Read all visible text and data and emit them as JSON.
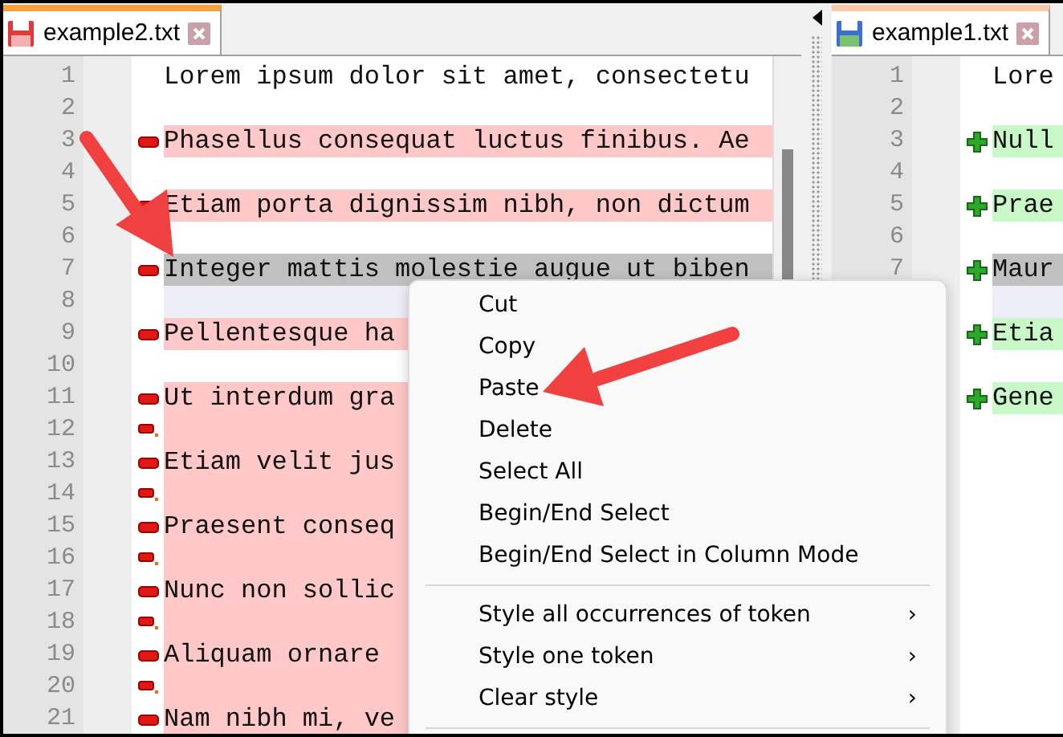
{
  "left_pane": {
    "tab": {
      "title": "example2.txt",
      "selected": true,
      "modified": true
    },
    "lines": [
      {
        "number": "1",
        "kind": "plain",
        "current": false,
        "text": "Lorem ipsum dolor sit amet, consectetu"
      },
      {
        "number": "2",
        "kind": "plain",
        "current": false
      },
      {
        "number": "3",
        "kind": "removed",
        "current": false,
        "text": "Phasellus consequat luctus finibus. Ae"
      },
      {
        "number": "4",
        "kind": "plain",
        "current": false
      },
      {
        "number": "5",
        "kind": "removed",
        "current": false,
        "text": "Etiam porta dignissim nibh, non dictum"
      },
      {
        "number": "6",
        "kind": "plain",
        "current": false
      },
      {
        "number": "7",
        "kind": "removed",
        "current": true,
        "text": "Integer mattis molestie augue ut biben"
      },
      {
        "number": "8",
        "kind": "filler",
        "current": false
      },
      {
        "number": "9",
        "kind": "removed",
        "current": false,
        "text": "Pellentesque ha"
      },
      {
        "number": "10",
        "kind": "plain",
        "current": false
      },
      {
        "number": "11",
        "kind": "removed",
        "current": false,
        "text": "Ut interdum gra"
      },
      {
        "number": "12",
        "kind": "removed-blank",
        "current": false
      },
      {
        "number": "13",
        "kind": "removed",
        "current": false,
        "text": "Etiam velit jus"
      },
      {
        "number": "14",
        "kind": "removed-blank",
        "current": false
      },
      {
        "number": "15",
        "kind": "removed",
        "current": false,
        "text": "Praesent conseq"
      },
      {
        "number": "16",
        "kind": "removed-blank",
        "current": false
      },
      {
        "number": "17",
        "kind": "removed",
        "current": false,
        "text": "Nunc non sollic"
      },
      {
        "number": "18",
        "kind": "removed-blank",
        "current": false
      },
      {
        "number": "19",
        "kind": "removed",
        "current": false,
        "text": "Aliquam ornare"
      },
      {
        "number": "20",
        "kind": "removed-blank",
        "current": false
      },
      {
        "number": "21",
        "kind": "removed",
        "current": false,
        "text": "Nam nibh mi, ve"
      }
    ]
  },
  "right_pane": {
    "tab": {
      "title": "example1.txt",
      "selected": false,
      "modified": false
    },
    "lines": [
      {
        "number": "1",
        "kind": "plain",
        "current": false,
        "text": "Lore"
      },
      {
        "number": "2",
        "kind": "plain",
        "current": false
      },
      {
        "number": "3",
        "kind": "added",
        "current": false,
        "text": "Null"
      },
      {
        "number": "4",
        "kind": "plain",
        "current": false
      },
      {
        "number": "5",
        "kind": "added",
        "current": false,
        "text": "Prae"
      },
      {
        "number": "6",
        "kind": "plain",
        "current": false
      },
      {
        "number": "7",
        "kind": "added",
        "current": true,
        "text": "Maur"
      },
      {
        "kind": "filler",
        "current": false
      },
      {
        "kind": "added",
        "current": false,
        "text": "Etia"
      },
      {
        "kind": "plain",
        "current": false
      },
      {
        "kind": "added",
        "current": false,
        "text": "Gene"
      }
    ]
  },
  "context_menu": {
    "items": [
      {
        "kind": "item",
        "label": "Cut"
      },
      {
        "kind": "item",
        "label": "Copy"
      },
      {
        "kind": "item",
        "label": "Paste"
      },
      {
        "kind": "item",
        "label": "Delete"
      },
      {
        "kind": "item",
        "label": "Select All"
      },
      {
        "kind": "item",
        "label": "Begin/End Select"
      },
      {
        "kind": "item",
        "label": "Begin/End Select in Column Mode"
      },
      {
        "kind": "separator"
      },
      {
        "kind": "submenu",
        "label": "Style all occurrences of token",
        "arrow": "›"
      },
      {
        "kind": "submenu",
        "label": "Style one token",
        "arrow": "›"
      },
      {
        "kind": "submenu",
        "label": "Clear style",
        "arrow": "›"
      },
      {
        "kind": "separator"
      }
    ]
  }
}
